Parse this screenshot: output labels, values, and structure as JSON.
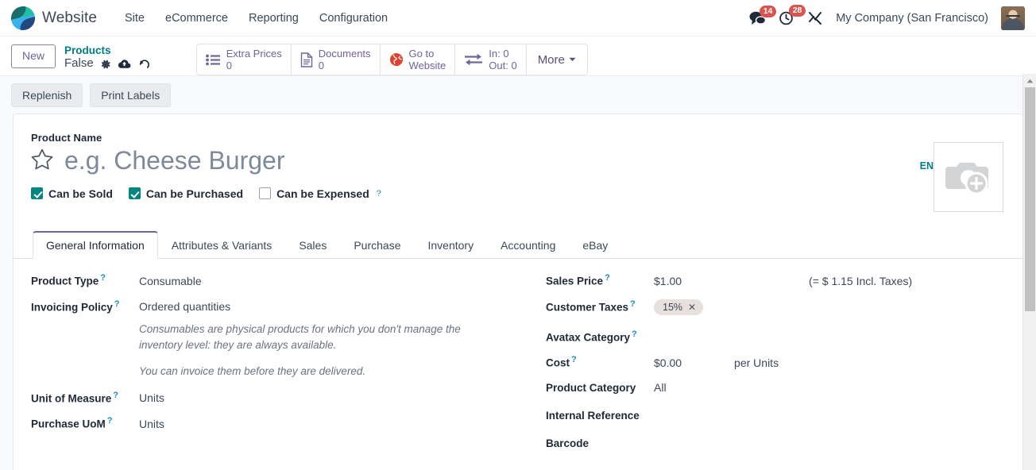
{
  "navbar": {
    "brand": "Website",
    "menus": [
      "Site",
      "eCommerce",
      "Reporting",
      "Configuration"
    ],
    "messages_count": "14",
    "activities_count": "28",
    "company": "My Company (San Francisco)"
  },
  "control_panel": {
    "new_button": "New",
    "breadcrumb_parent": "Products",
    "breadcrumb_current": "False",
    "stat_buttons": [
      {
        "label": "Extra Prices",
        "value": "0",
        "icon": "list-icon"
      },
      {
        "label": "Documents",
        "value": "0",
        "icon": "document-icon"
      },
      {
        "label": "Go to",
        "value": "Website",
        "icon": "globe-icon"
      },
      {
        "label": "In: 0",
        "value": "Out: 0",
        "icon": "exchange-icon"
      }
    ],
    "more_label": "More"
  },
  "button_strip": {
    "replenish": "Replenish",
    "print_labels": "Print Labels"
  },
  "product": {
    "name_label": "Product Name",
    "name_placeholder": "e.g. Cheese Burger",
    "language_badge": "EN",
    "checkboxes": [
      {
        "label": "Can be Sold",
        "checked": true,
        "has_help": false
      },
      {
        "label": "Can be Purchased",
        "checked": true,
        "has_help": false
      },
      {
        "label": "Can be Expensed",
        "checked": false,
        "has_help": true
      }
    ]
  },
  "tabs": [
    {
      "label": "General Information",
      "active": true
    },
    {
      "label": "Attributes & Variants",
      "active": false
    },
    {
      "label": "Sales",
      "active": false
    },
    {
      "label": "Purchase",
      "active": false
    },
    {
      "label": "Inventory",
      "active": false
    },
    {
      "label": "Accounting",
      "active": false
    },
    {
      "label": "eBay",
      "active": false
    }
  ],
  "general_information": {
    "left": {
      "product_type_label": "Product Type",
      "product_type_value": "Consumable",
      "invoicing_policy_label": "Invoicing Policy",
      "invoicing_policy_value": "Ordered quantities",
      "help_1": "Consumables are physical products for which you don't manage the inventory level: they are always available.",
      "help_2": "You can invoice them before they are delivered.",
      "uom_label": "Unit of Measure",
      "uom_value": "Units",
      "purchase_uom_label": "Purchase UoM",
      "purchase_uom_value": "Units"
    },
    "right": {
      "sales_price_label": "Sales Price",
      "sales_price_value": "$1.00",
      "sales_price_incl": "(= $ 1.15 Incl. Taxes)",
      "customer_taxes_label": "Customer Taxes",
      "customer_taxes_tag": "15%",
      "avatax_label": "Avatax Category",
      "avatax_value": "",
      "cost_label": "Cost",
      "cost_value": "$0.00",
      "cost_suffix": "per Units",
      "product_category_label": "Product Category",
      "product_category_value": "All",
      "internal_reference_label": "Internal Reference",
      "internal_reference_value": "",
      "barcode_label": "Barcode",
      "barcode_value": ""
    }
  },
  "colors": {
    "accent_purple": "#71639b",
    "teal": "#017e84",
    "checkbox_teal": "#00867e",
    "badge_red": "#d9534f"
  }
}
